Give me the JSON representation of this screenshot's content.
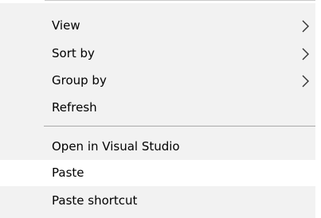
{
  "context_menu": {
    "items": [
      {
        "label": "View",
        "has_submenu": true,
        "icon": "chevron-right-icon"
      },
      {
        "label": "Sort by",
        "has_submenu": true,
        "icon": "chevron-right-icon"
      },
      {
        "label": "Group by",
        "has_submenu": true,
        "icon": "chevron-right-icon"
      },
      {
        "label": "Refresh",
        "has_submenu": false
      },
      {
        "label": "Open in Visual Studio",
        "has_submenu": false
      },
      {
        "label": "Paste",
        "has_submenu": false,
        "highlighted": true
      },
      {
        "label": "Paste shortcut",
        "has_submenu": false
      }
    ],
    "colors": {
      "background": "#f2f2f2",
      "highlight": "#ffffff",
      "separator": "#a9a9a9",
      "text": "#000000"
    }
  }
}
